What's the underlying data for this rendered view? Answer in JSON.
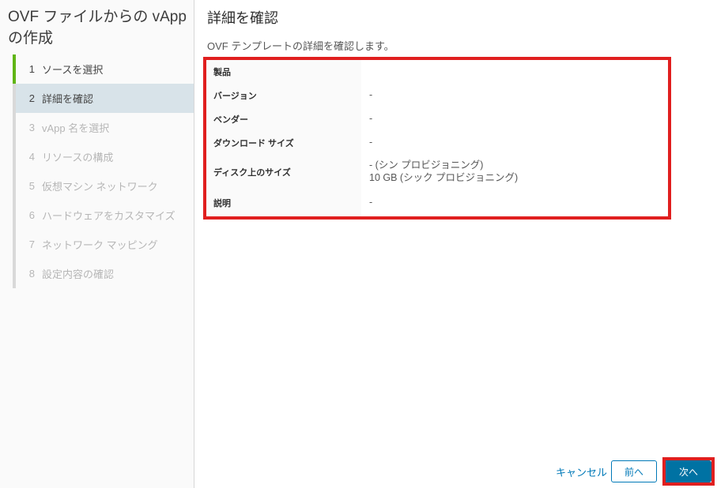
{
  "wizard": {
    "title": "OVF ファイルからの vApp の作成"
  },
  "steps": [
    {
      "key": "select-source",
      "num": "1",
      "label": "ソースを選択",
      "state": "completed"
    },
    {
      "key": "review-details",
      "num": "2",
      "label": "詳細を確認",
      "state": "active"
    },
    {
      "key": "select-vapp-name",
      "num": "3",
      "label": "vApp 名を選択",
      "state": "upcoming"
    },
    {
      "key": "configure-resources",
      "num": "4",
      "label": "リソースの構成",
      "state": "upcoming"
    },
    {
      "key": "vm-networks",
      "num": "5",
      "label": "仮想マシン ネットワーク",
      "state": "upcoming"
    },
    {
      "key": "customize-hardware",
      "num": "6",
      "label": "ハードウェアをカスタマイズ",
      "state": "upcoming"
    },
    {
      "key": "network-mapping",
      "num": "7",
      "label": "ネットワーク マッピング",
      "state": "upcoming"
    },
    {
      "key": "review-settings",
      "num": "8",
      "label": "設定内容の確認",
      "state": "upcoming"
    }
  ],
  "main": {
    "title": "詳細を確認",
    "subtitle": "OVF テンプレートの詳細を確認します。",
    "details": [
      {
        "key": "product",
        "label": "製品",
        "value": ""
      },
      {
        "key": "version",
        "label": "バージョン",
        "value": "-"
      },
      {
        "key": "vendor",
        "label": "ベンダー",
        "value": "-"
      },
      {
        "key": "download-size",
        "label": "ダウンロード サイズ",
        "value": "-"
      },
      {
        "key": "size-on-disk",
        "label": "ディスク上のサイズ",
        "value": "- (シン プロビジョニング)\n10 GB (シック プロビジョニング)"
      },
      {
        "key": "description",
        "label": "説明",
        "value": "-"
      }
    ]
  },
  "footer": {
    "cancel": "キャンセル",
    "prev": "前へ",
    "next": "次へ"
  },
  "colors": {
    "primary_blue": "#0072a3",
    "link_blue": "#0079b8",
    "completed_green": "#60b515",
    "active_step_bg": "#d8e3e9",
    "annotation_red": "#e01f1f",
    "label_column_bg": "#fafafa"
  }
}
